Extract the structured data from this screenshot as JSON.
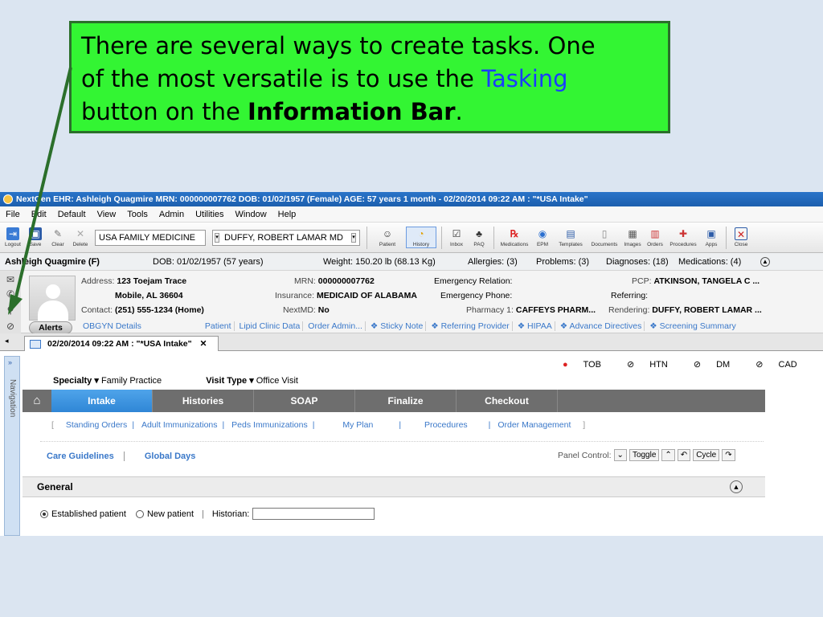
{
  "callout": {
    "line1": "There are several ways to create tasks.  One",
    "line2a": "of the most versatile is to use the ",
    "line2b": "Tasking",
    "line3a": "button on the ",
    "line3b": "Information Bar",
    "line3c": "."
  },
  "window": {
    "title": "NextGen EHR: Ashleigh Quagmire  MRN: 000000007762  DOB: 01/02/1957  (Female)  AGE: 57 years 1 month - 02/20/2014 09:22 AM : \"*USA Intake\""
  },
  "menu": [
    "File",
    "Edit",
    "Default",
    "View",
    "Tools",
    "Admin",
    "Utilities",
    "Window",
    "Help"
  ],
  "toolbar": {
    "left": [
      "Logout",
      "Save",
      "Clear",
      "Delete"
    ],
    "practice": "USA FAMILY MEDICINE",
    "provider": "DUFFY, ROBERT LAMAR MD",
    "right": [
      "Patient",
      "History",
      "Inbox",
      "PAQ",
      "Medications",
      "EPM",
      "Templates",
      "Documents",
      "Images",
      "Orders",
      "Procedures",
      "Apps",
      "Close"
    ]
  },
  "patient": {
    "name": "Ashleigh Quagmire (F)",
    "dob": "DOB: 01/02/1957 (57 years)",
    "weight": "Weight: 150.20 lb (68.13 Kg)",
    "allergies": "Allergies: (3)",
    "problems": "Problems: (3)",
    "diagnoses": "Diagnoses: (18)",
    "medications": "Medications: (4)",
    "address_label": "Address:",
    "address1": "123 Toejam Trace",
    "address2": "Mobile, AL 36604",
    "contact_label": "Contact:",
    "contact": "(251) 555-1234 (Home)",
    "mrn_label": "MRN:",
    "mrn": "000000007762",
    "insurance_label": "Insurance:",
    "insurance": "MEDICAID OF ALABAMA",
    "nextmd_label": "NextMD:",
    "nextmd": "No",
    "emerg_rel": "Emergency Relation:",
    "emerg_phone": "Emergency Phone:",
    "pharmacy_label": "Pharmacy 1:",
    "pharmacy": "CAFFEYS PHARM...",
    "pcp_label": "PCP:",
    "pcp": "ATKINSON, TANGELA C ...",
    "referring": "Referring:",
    "rendering_label": "Rendering:",
    "rendering": "DUFFY, ROBERT LAMAR ..."
  },
  "links": {
    "alerts": "Alerts",
    "items": [
      "OBGYN Details",
      "Patient",
      "Lipid Clinic Data",
      "Order Admin...",
      "❖ Sticky Note",
      "❖ Referring Provider",
      "❖ HIPAA",
      "❖ Advance Directives",
      "❖ Screening Summary"
    ]
  },
  "doc_tab": {
    "label": "02/20/2014 09:22 AM : \"*USA Intake\"",
    "close": "✕"
  },
  "encounter": {
    "nav_label": "Navigation",
    "flags": [
      "TOB",
      "HTN",
      "DM",
      "CAD"
    ],
    "specialty_label": "Specialty ▾",
    "specialty": "Family Practice",
    "visit_label": "Visit Type ▾",
    "visit": "Office Visit",
    "tabs": [
      "Intake",
      "Histories",
      "SOAP",
      "Finalize",
      "Checkout"
    ],
    "subtabs": [
      "Standing Orders",
      "Adult Immunizations",
      "Peds Immunizations",
      "My Plan",
      "Procedures",
      "Order Management"
    ],
    "care": "Care Guidelines",
    "global": "Global Days",
    "panel_label": "Panel Control:",
    "toggle": "Toggle",
    "cycle": "Cycle",
    "general": "General",
    "established": "Established patient",
    "new": "New patient",
    "historian": "Historian:"
  }
}
